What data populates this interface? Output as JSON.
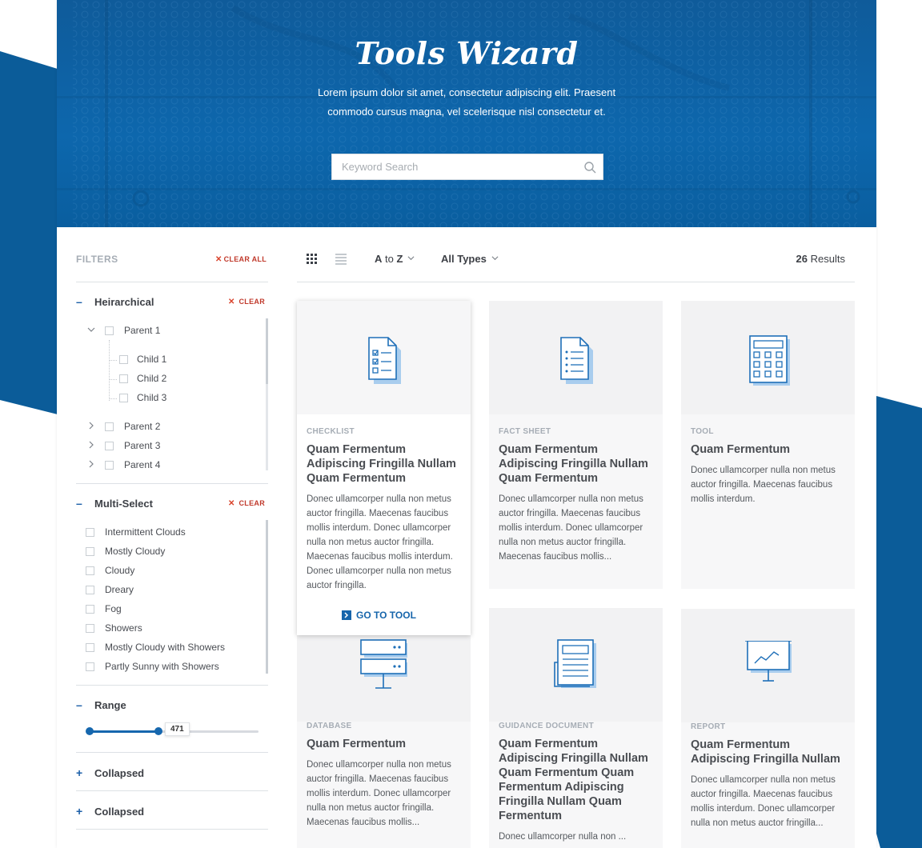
{
  "hero": {
    "title": "Tools Wizard",
    "subtitle": "Lorem ipsum dolor sit amet, consectetur adipiscing elit. Praesent commodo cursus magna, vel scelerisque nisl consectetur et.",
    "search_placeholder": "Keyword Search",
    "search_icon": "search-icon"
  },
  "sidebar": {
    "filters_label": "FILTERS",
    "clear_all_label": "CLEAR ALL",
    "clear_label": "CLEAR",
    "hierarchical": {
      "title": "Heirarchical",
      "parents": [
        {
          "label": "Parent 1",
          "expanded": true,
          "children": [
            "Child 1",
            "Child 2",
            "Child 3"
          ]
        },
        {
          "label": "Parent 2",
          "expanded": false
        },
        {
          "label": "Parent 3",
          "expanded": false
        },
        {
          "label": "Parent 4",
          "expanded": false
        }
      ]
    },
    "multi_select": {
      "title": "Multi-Select",
      "options": [
        "Intermittent Clouds",
        "Mostly Cloudy",
        "Cloudy",
        "Dreary",
        "Fog",
        "Showers",
        "Mostly Cloudy with Showers",
        "Partly Sunny with Showers"
      ]
    },
    "range": {
      "title": "Range",
      "value": "471",
      "fraction": 0.41
    },
    "collapsed_sections": [
      {
        "title": "Collapsed"
      },
      {
        "title": "Collapsed"
      }
    ]
  },
  "toolbar": {
    "sort_a": "A",
    "sort_to": "to",
    "sort_z": "Z",
    "type_filter": "All Types",
    "results_count": "26",
    "results_label": "Results"
  },
  "cards": [
    {
      "type": "CHECKLIST",
      "title": "Quam Fermentum Adipiscing Fringilla Nullam Quam Fermentum",
      "desc": "Donec ullamcorper nulla non metus auctor fringilla. Maecenas faucibus mollis interdum. Donec ullamcorper nulla non metus auctor fringilla. Maecenas faucibus mollis interdum. Donec ullamcorper nulla non metus auctor fringilla.",
      "cta": "GO TO TOOL",
      "icon": "checklist-icon"
    },
    {
      "type": "FACT SHEET",
      "title": "Quam Fermentum Adipiscing Fringilla Nullam Quam Fermentum",
      "desc": "Donec ullamcorper nulla non metus auctor fringilla. Maecenas faucibus mollis interdum. Donec ullamcorper nulla non metus auctor fringilla. Maecenas faucibus mollis...",
      "icon": "fact-sheet-icon"
    },
    {
      "type": "TOOL",
      "title": "Quam Fermentum",
      "desc": "Donec ullamcorper nulla non metus auctor fringilla. Maecenas faucibus mollis interdum.",
      "icon": "calculator-icon"
    },
    {
      "type": "DATABASE",
      "title": "Quam Fermentum",
      "desc": "Donec ullamcorper nulla non metus auctor fringilla. Maecenas faucibus mollis interdum. Donec ullamcorper nulla non metus auctor fringilla. Maecenas faucibus mollis...",
      "icon": "database-icon"
    },
    {
      "type": "GUIDANCE DOCUMENT",
      "title": "Quam Fermentum Adipiscing Fringilla Nullam Quam Fermentum Quam Fermentum Adipiscing Fringilla Nullam Quam Fermentum",
      "desc": "Donec ullamcorper nulla non ...",
      "icon": "guidance-document-icon"
    },
    {
      "type": "REPORT",
      "title": "Quam Fermentum Adipiscing Fringilla Nullam",
      "desc": "Donec ullamcorper nulla non metus auctor fringilla. Maecenas faucibus mollis interdum. Donec ullamcorper nulla non metus auctor fringilla...",
      "icon": "report-icon"
    }
  ],
  "colors": {
    "brand_blue": "#0d5f9e",
    "accent_blue": "#1665ab",
    "clear_red": "#c0392b",
    "icon_blue": "#1e6fb8",
    "icon_fill": "#a9cdee"
  }
}
